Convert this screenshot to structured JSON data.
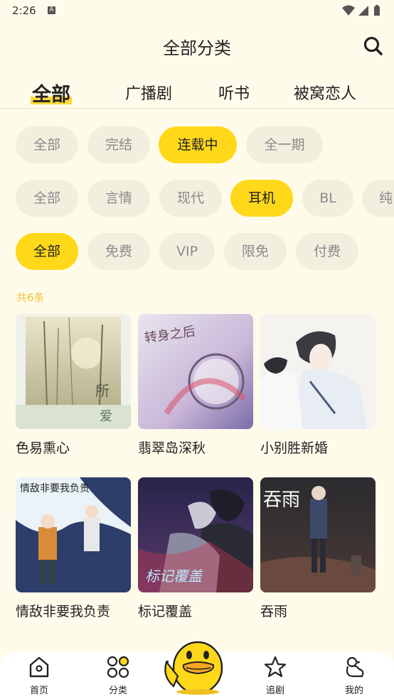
{
  "status": {
    "time": "2:26",
    "badge": "A"
  },
  "header": {
    "title": "全部分类"
  },
  "tabs": [
    {
      "label": "全部",
      "active": true
    },
    {
      "label": "广播剧",
      "active": false
    },
    {
      "label": "听书",
      "active": false
    },
    {
      "label": "被窝恋人",
      "active": false
    }
  ],
  "filters": {
    "status": [
      "全部",
      "完结",
      "连载中",
      "全一期"
    ],
    "status_selected": "连载中",
    "genre": [
      "全部",
      "言情",
      "现代",
      "耳机",
      "BL",
      "纯"
    ],
    "genre_selected": "耳机",
    "price": [
      "全部",
      "免费",
      "VIP",
      "限免",
      "付费"
    ],
    "price_selected": "全部"
  },
  "result_count": "共6条",
  "items": [
    {
      "title": "色易熏心",
      "cover_text": [
        "所",
        "爱"
      ]
    },
    {
      "title": "翡翠岛深秋",
      "cover_text": [
        "转身之后"
      ]
    },
    {
      "title": "小别胜新婚",
      "cover_text": []
    },
    {
      "title": "情敌非要我负责",
      "cover_text": [
        "情敌非要我负责"
      ]
    },
    {
      "title": "标记覆盖",
      "cover_text": [
        "标记覆盖"
      ]
    },
    {
      "title": "吞雨",
      "cover_text": [
        "吞雨"
      ]
    }
  ],
  "bottom_nav": [
    {
      "label": "首页",
      "icon": "home-icon"
    },
    {
      "label": "分类",
      "icon": "category-icon"
    },
    {
      "label": "",
      "icon": "duck-mascot"
    },
    {
      "label": "追剧",
      "icon": "star-icon"
    },
    {
      "label": "我的",
      "icon": "duck-profile-icon"
    }
  ],
  "colors": {
    "accent": "#ffd81a",
    "background": "#fffbea",
    "chip": "#f3efdf",
    "count": "#f2c33b"
  }
}
